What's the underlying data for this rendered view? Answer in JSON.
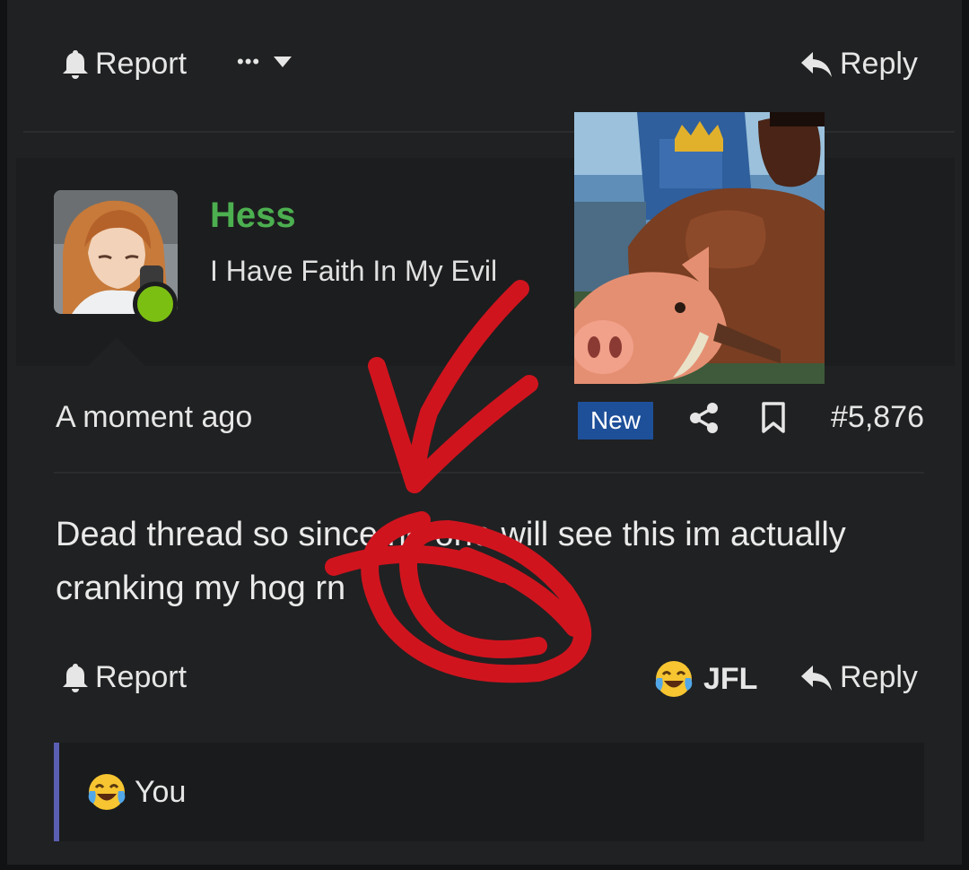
{
  "top_bar": {
    "report_label": "Report",
    "more_label": "•••",
    "reply_label": "Reply"
  },
  "post": {
    "author": {
      "name": "Hess",
      "title": "I Have Faith In My Evil",
      "online": true
    },
    "timestamp": "A moment ago",
    "badge": "New",
    "post_number": "#5,876",
    "body": "Dead thread so since no one will see this im actually cranking my hog rn"
  },
  "actions": {
    "report_label": "Report",
    "reaction_label": "JFL",
    "reply_label": "Reply"
  },
  "reactions_summary": {
    "label": "You"
  },
  "colors": {
    "username": "#4caf50",
    "badge_bg": "#1e4f99",
    "online": "#7cbf13",
    "annotation": "#d0141e",
    "reaction_bar": "#5b5fb3"
  },
  "icons": [
    "bell-icon",
    "ellipsis-icon",
    "chevron-down-icon",
    "reply-arrow-icon",
    "share-icon",
    "bookmark-icon",
    "crying-laughing-emoji-icon"
  ]
}
